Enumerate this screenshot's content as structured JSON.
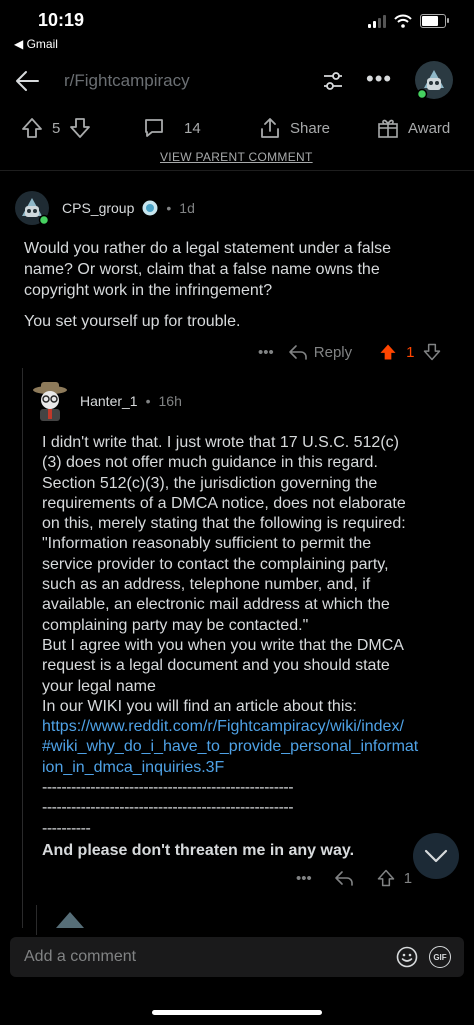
{
  "status": {
    "time": "10:19",
    "back_label": "◀ Gmail"
  },
  "nav": {
    "title": "r/Fightcampiracy",
    "more": "•••"
  },
  "actions": {
    "upvotes": "5",
    "comments": "14",
    "share": "Share",
    "award": "Award"
  },
  "view_parent": "VIEW PARENT COMMENT",
  "comment1": {
    "author": "CPS_group",
    "age": "1d",
    "paragraphs": [
      "Would you rather do a legal statement under a false name? Or worst, claim that a false name owns the copyright work in the infringement?",
      "You set yourself up for trouble."
    ],
    "reply": "Reply",
    "votes": "1",
    "more": "•••"
  },
  "comment2": {
    "author": "Hanter_1",
    "age": "16h",
    "body_lines": [
      "I didn't write that. I just wrote that 17 U.S.C. 512(c)",
      "(3) does not offer much guidance in this regard.",
      "Section 512(c)(3), the jurisdiction governing the",
      "requirements of a DMCA notice, does not elaborate",
      "on this, merely stating that the following is required:",
      "\"Information reasonably sufficient to permit the",
      "service provider to contact the complaining party,",
      "such as an address, telephone number, and, if",
      "available, an electronic mail address at which the",
      "complaining party may be contacted.\"",
      "But I agree with you when you write that the DMCA",
      "request is a legal document and you should state",
      "your legal name",
      "In our WIKI you will find an article about this:"
    ],
    "link_lines": [
      "https://www.reddit.com/r/Fightcampiracy/wiki/index/",
      "#wiki_why_do_i_have_to_provide_personal_informat",
      "ion_in_dmca_inquiries.3F"
    ],
    "dash_lines": [
      "----------------------------------------------------",
      "----------------------------------------------------",
      "----------"
    ],
    "closing": "And please don't threaten me in any way.",
    "votes": "1",
    "more": "•••"
  },
  "composer": {
    "placeholder": "Add a comment",
    "gif": "GIF"
  },
  "colors": {
    "upvote_active": "#ff4500",
    "link": "#4fa2e6",
    "background": "#000000"
  }
}
